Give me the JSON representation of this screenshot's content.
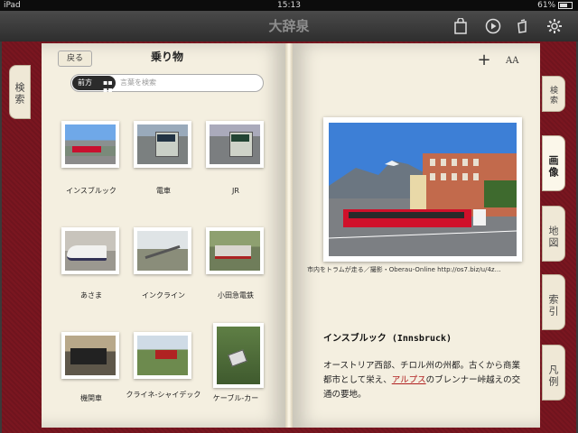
{
  "status": {
    "carrier": "iPad",
    "time": "15:13",
    "battery": "61%"
  },
  "app": {
    "title": "大辞泉"
  },
  "left_tab": {
    "label": "検索"
  },
  "left_page": {
    "back_label": "戻る",
    "category_title": "乗り物",
    "search": {
      "scope_label": "前方",
      "placeholder": "言葉を検索"
    },
    "items": [
      {
        "label": "インスブルック"
      },
      {
        "label": "電車"
      },
      {
        "label": "JR"
      },
      {
        "label": "あさま"
      },
      {
        "label": "インクライン"
      },
      {
        "label": "小田急電鉄"
      },
      {
        "label": "機関車"
      },
      {
        "label": "クライネ-シャイデック"
      },
      {
        "label": "ケーブル-カー"
      }
    ]
  },
  "right_tabs": [
    {
      "label": "検索"
    },
    {
      "label": "画像"
    },
    {
      "label": "地図"
    },
    {
      "label": "索引"
    },
    {
      "label": "凡例"
    }
  ],
  "toolbar": {
    "plus_label": "+",
    "font_label": "AA"
  },
  "entry": {
    "photo_credit": "市内をトラムが走る／撮影・Oberau-Online http://os7.biz/u/4z…",
    "title": "インスブルック (Innsbruck)",
    "body_prefix": "オーストリア西部、チロル州の州都。古くから商業都市として栄え、",
    "body_link": "アルプス",
    "body_suffix": "のブレンナー峠越えの交通の要地。"
  },
  "colors": {
    "cover": "#7a1620",
    "page": "#f4efe0",
    "link": "#b02020"
  }
}
